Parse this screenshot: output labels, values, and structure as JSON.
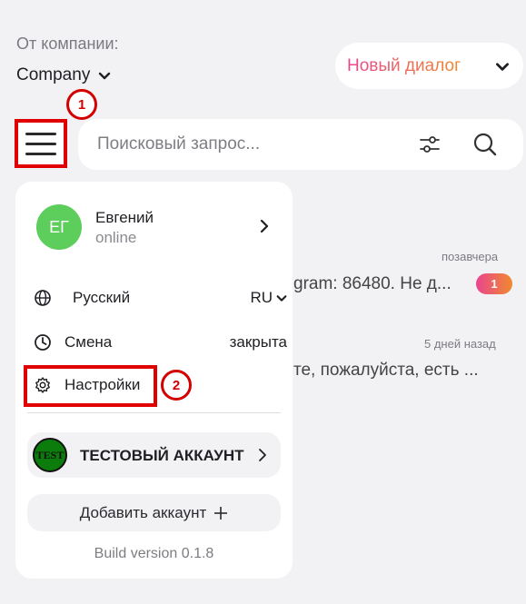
{
  "header": {
    "company_label": "От компании:",
    "company_value": "Company",
    "new_dialog_label": "Новый диалог"
  },
  "search": {
    "placeholder": "Поисковый запрос..."
  },
  "chats": [
    {
      "preview": "gram: 86480. Не д...",
      "time": "позавчера",
      "unread": "1"
    },
    {
      "preview": "те, пожалуйста, есть ...",
      "time": "5 дней назад"
    }
  ],
  "menu": {
    "user": {
      "initials": "ЕГ",
      "name": "Евгений",
      "status": "online"
    },
    "language": {
      "label": "Русский",
      "value": "RU"
    },
    "shift": {
      "label": "Смена",
      "value": "закрыта"
    },
    "settings_label": "Настройки",
    "test_account": {
      "logo_text": "TEST",
      "name": "ТЕСТОВЫЙ АККАУНТ"
    },
    "add_account_label": "Добавить аккаунт",
    "build_version": "Build version 0.1.8"
  },
  "annotations": [
    "1",
    "2"
  ],
  "icons": [
    "chevron-down-icon",
    "menu-icon",
    "filter-icon",
    "search-icon",
    "chevron-right-icon",
    "globe-icon",
    "clock-icon",
    "gear-icon",
    "plus-icon"
  ],
  "colors": {
    "accent_start": "#e94590",
    "accent_end": "#f08a2d",
    "annotation_red": "#e10000",
    "avatar_green": "#5dcd5b"
  }
}
